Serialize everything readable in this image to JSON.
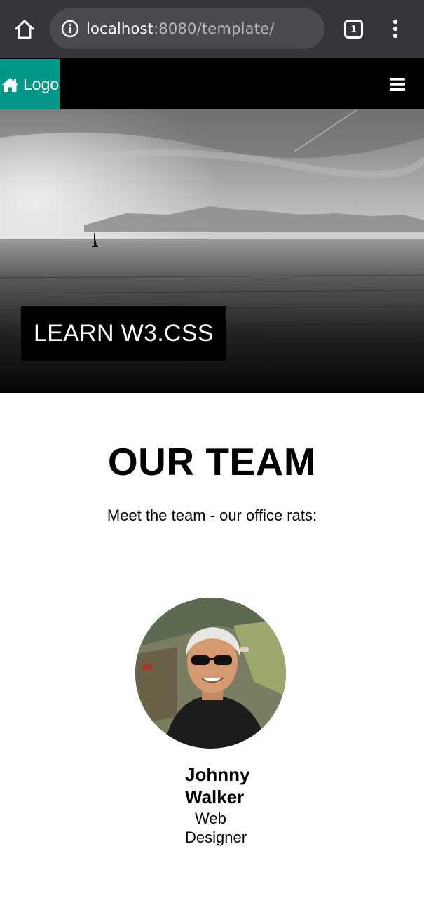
{
  "browser": {
    "url_host": "localhost",
    "url_path": ":8080/template/",
    "tab_count": "1"
  },
  "navbar": {
    "logo_label": "Logo"
  },
  "hero": {
    "caption": "LEARN W3.CSS"
  },
  "team": {
    "title": "OUR TEAM",
    "subtitle": "Meet the team - our office rats:",
    "members": [
      {
        "name": "Johnny Walker",
        "role": "Web Designer"
      }
    ]
  },
  "colors": {
    "chrome_bg": "#35363a",
    "urlbar_bg": "#4a4b4f",
    "logo_teal": "#009688",
    "navbar_bg": "#000000"
  },
  "icons": {
    "home": "home-icon",
    "info": "info-icon",
    "tabs": "tab-switcher-icon",
    "menu": "more-vert-icon",
    "logo": "house-icon",
    "nav_menu": "hamburger-icon"
  }
}
